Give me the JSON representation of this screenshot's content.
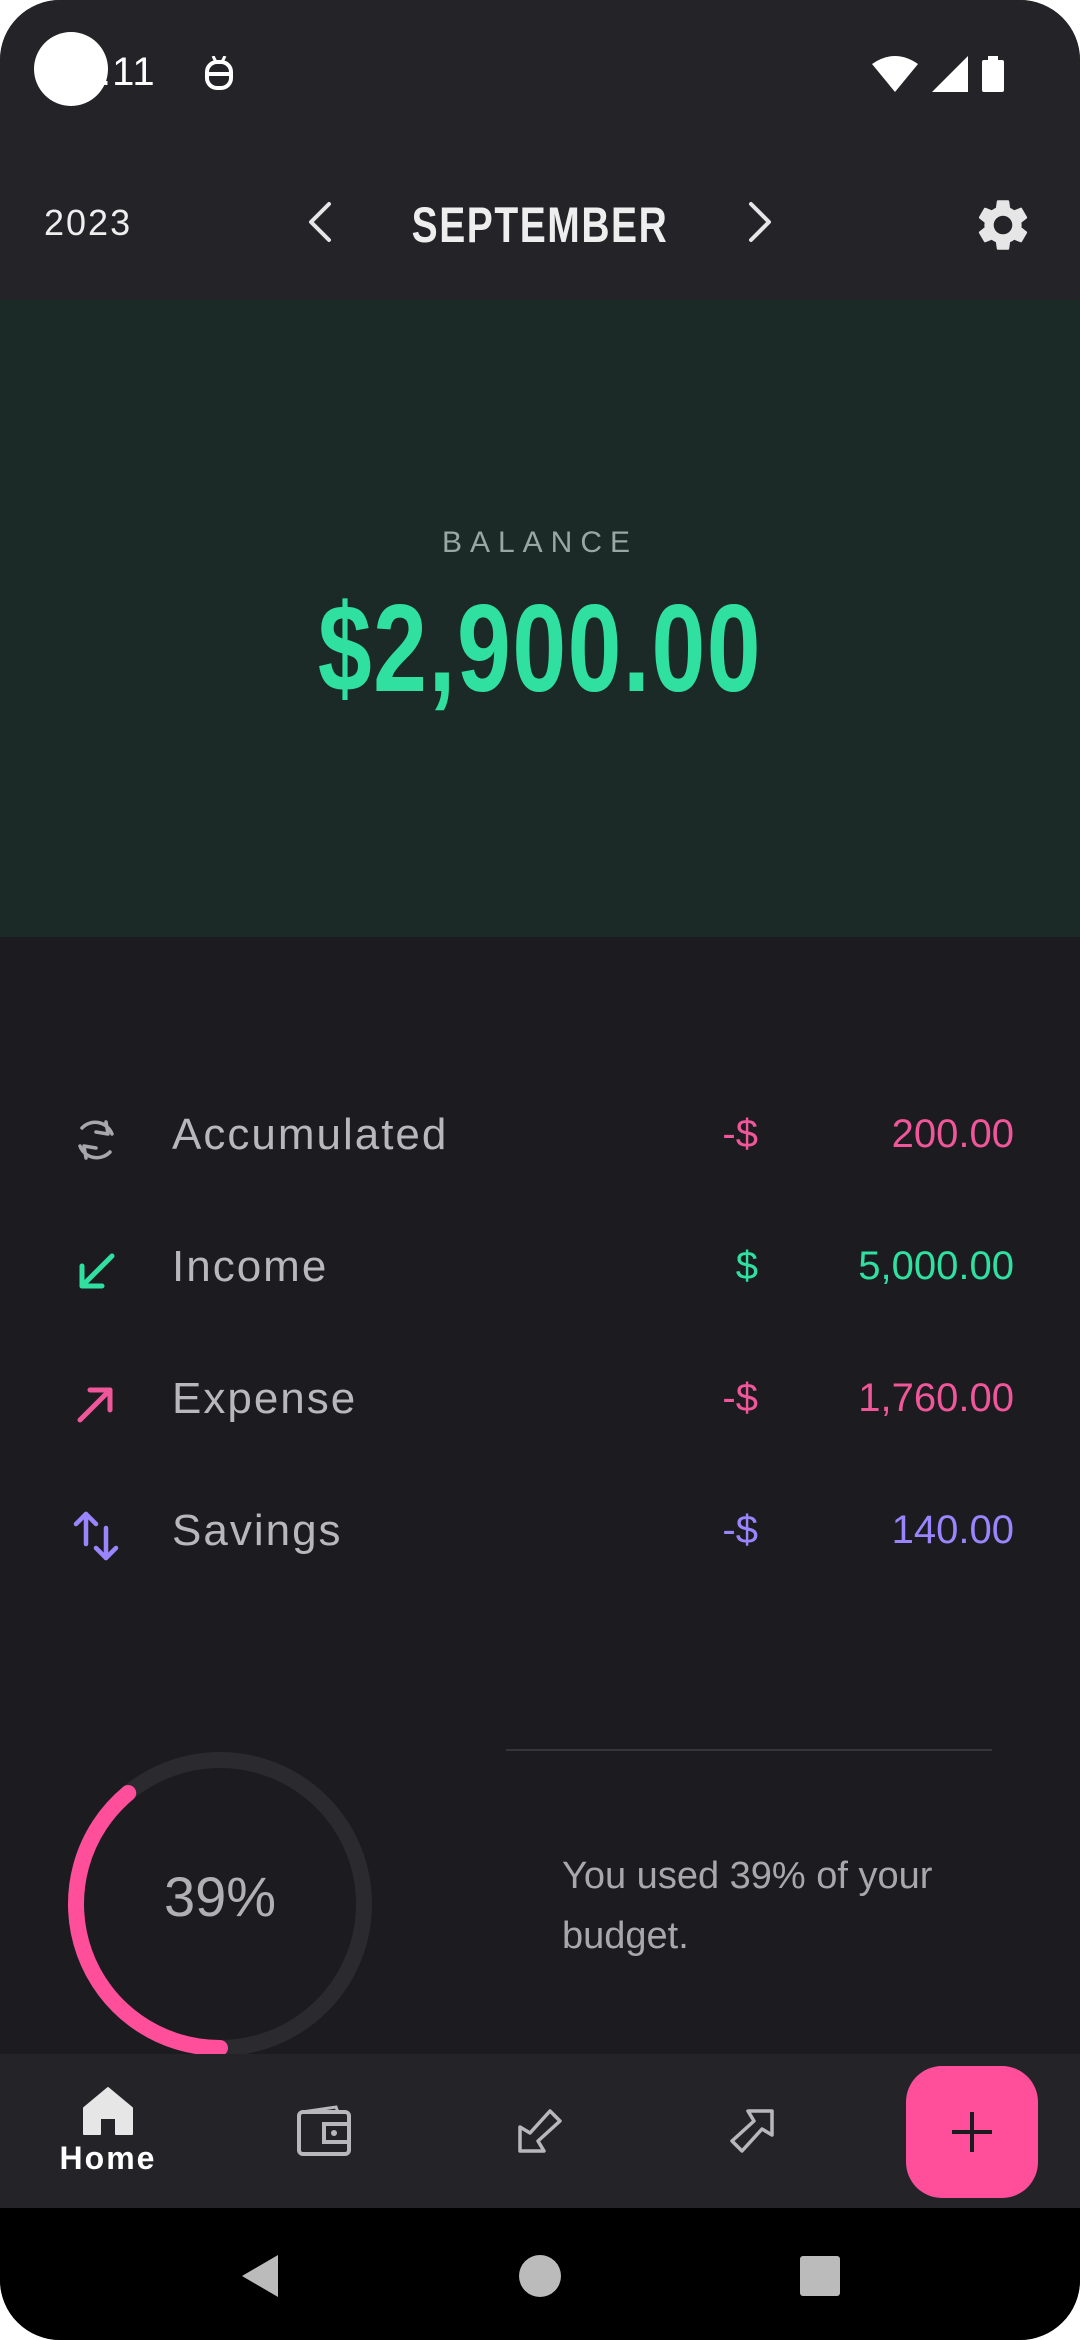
{
  "status_bar": {
    "time": ":11",
    "icons": [
      "android-icon",
      "wifi-icon",
      "signal-icon",
      "battery-icon"
    ]
  },
  "header": {
    "year": "2023",
    "month": "SEPTEMBER",
    "prev_icon": "chevron-left-icon",
    "next_icon": "chevron-right-icon",
    "settings_icon": "gear-icon"
  },
  "balance": {
    "label": "BALANCE",
    "amount": "$2,900.00"
  },
  "summary": [
    {
      "label": "Accumulated",
      "currency": "-$",
      "value": "200.00",
      "icon": "refresh-icon",
      "color": "#f0569a"
    },
    {
      "label": "Income",
      "currency": "$",
      "value": "5,000.00",
      "icon": "arrow-down-left-icon",
      "color": "#2fe0a0"
    },
    {
      "label": "Expense",
      "currency": "-$",
      "value": "1,760.00",
      "icon": "arrow-up-right-icon",
      "color": "#f0569a"
    },
    {
      "label": "Savings",
      "currency": "-$",
      "value": "140.00",
      "icon": "swap-vertical-icon",
      "color": "#9b85ff"
    }
  ],
  "budget": {
    "percent_text": "39%",
    "percent_value": 0.39,
    "message": "You used 39% of your budget."
  },
  "bottom_nav": {
    "items": [
      {
        "label": "Home",
        "icon": "home-icon",
        "active": true
      },
      {
        "label": "",
        "icon": "wallet-icon"
      },
      {
        "label": "",
        "icon": "income-arrow-icon"
      },
      {
        "label": "",
        "icon": "expense-arrow-icon"
      }
    ],
    "fab_icon": "plus-icon"
  },
  "system_nav": {
    "icons": [
      "back-icon",
      "home-circle-icon",
      "recents-icon"
    ]
  },
  "colors": {
    "accent_green": "#2fe0a0",
    "accent_pink": "#f0569a",
    "accent_purple": "#9b85ff",
    "fab_pink": "#ff4f9a",
    "balance_bg": "#1b2a26",
    "surface": "#242428",
    "background": "#1c1c20"
  }
}
